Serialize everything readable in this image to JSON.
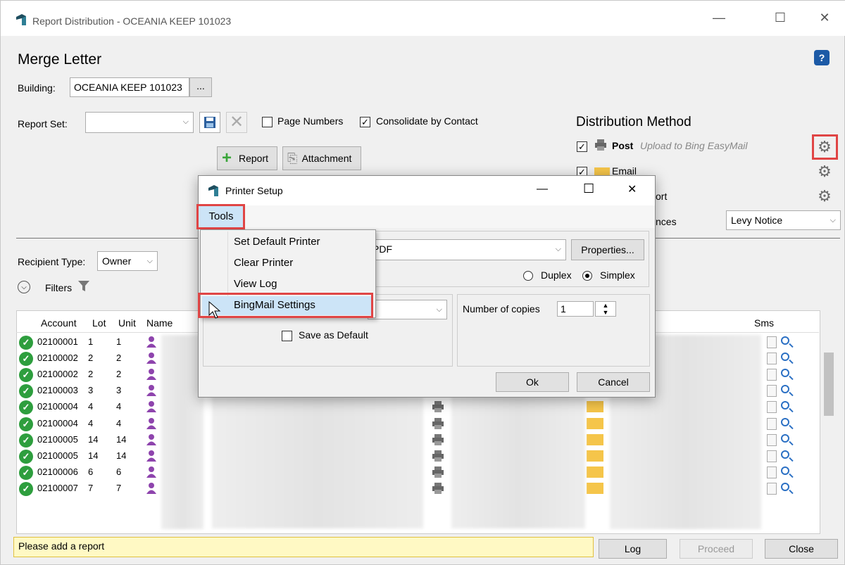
{
  "window": {
    "title": "Report Distribution - OCEANIA KEEP 101023",
    "minimize": "—",
    "maximize": "☐",
    "close": "✕"
  },
  "page": {
    "heading": "Merge Letter",
    "building_label": "Building:",
    "building_value": "OCEANIA KEEP 101023",
    "building_browse": "...",
    "report_set_label": "Report Set:",
    "report_set_value": "",
    "page_numbers_label": "Page Numbers",
    "consolidate_label": "Consolidate by Contact",
    "report_button": "Report",
    "attachment_button": "Attachment"
  },
  "distribution": {
    "heading": "Distribution Method",
    "post_label": "Post",
    "post_note": "Upload to Bing EasyMail",
    "email_label": "Email",
    "row3_label": "ort",
    "row4_label": "nces",
    "row4_value": "Levy Notice"
  },
  "filters": {
    "recipient_type_label": "Recipient Type:",
    "recipient_type_value": "Owner",
    "filters_label": "Filters"
  },
  "grid": {
    "headers": [
      "Account",
      "Lot",
      "Unit",
      "Name",
      "Sms"
    ],
    "rows": [
      {
        "account": "02100001",
        "lot": "1",
        "unit": "1"
      },
      {
        "account": "02100002",
        "lot": "2",
        "unit": "2"
      },
      {
        "account": "02100002",
        "lot": "2",
        "unit": "2"
      },
      {
        "account": "02100003",
        "lot": "3",
        "unit": "3"
      },
      {
        "account": "02100004",
        "lot": "4",
        "unit": "4"
      },
      {
        "account": "02100004",
        "lot": "4",
        "unit": "4"
      },
      {
        "account": "02100005",
        "lot": "14",
        "unit": "14"
      },
      {
        "account": "02100005",
        "lot": "14",
        "unit": "14"
      },
      {
        "account": "02100006",
        "lot": "6",
        "unit": "6"
      },
      {
        "account": "02100007",
        "lot": "7",
        "unit": "7"
      }
    ]
  },
  "footer": {
    "status": "Please add a report",
    "log_button": "Log",
    "proceed_button": "Proceed",
    "close_button": "Close"
  },
  "dialog": {
    "title": "Printer Setup",
    "minimize": "—",
    "maximize": "☐",
    "close": "✕",
    "tools_menu": "Tools",
    "printer_value": "PDF",
    "properties_button": "Properties...",
    "duplex_label": "Duplex",
    "simplex_label": "Simplex",
    "save_default_label": "Save as Default",
    "copies_label": "Number of copies",
    "copies_value": "1",
    "ok_button": "Ok",
    "cancel_button": "Cancel"
  },
  "tools_menu_items": [
    "Set Default Printer",
    "Clear Printer",
    "View Log",
    "BingMail Settings"
  ],
  "colors": {
    "highlight_red": "#e04545",
    "menu_highlight": "#cce4f7",
    "status_bg": "#fff9c4",
    "ok_green": "#2e9e3e",
    "person_purple": "#8e44ad"
  }
}
